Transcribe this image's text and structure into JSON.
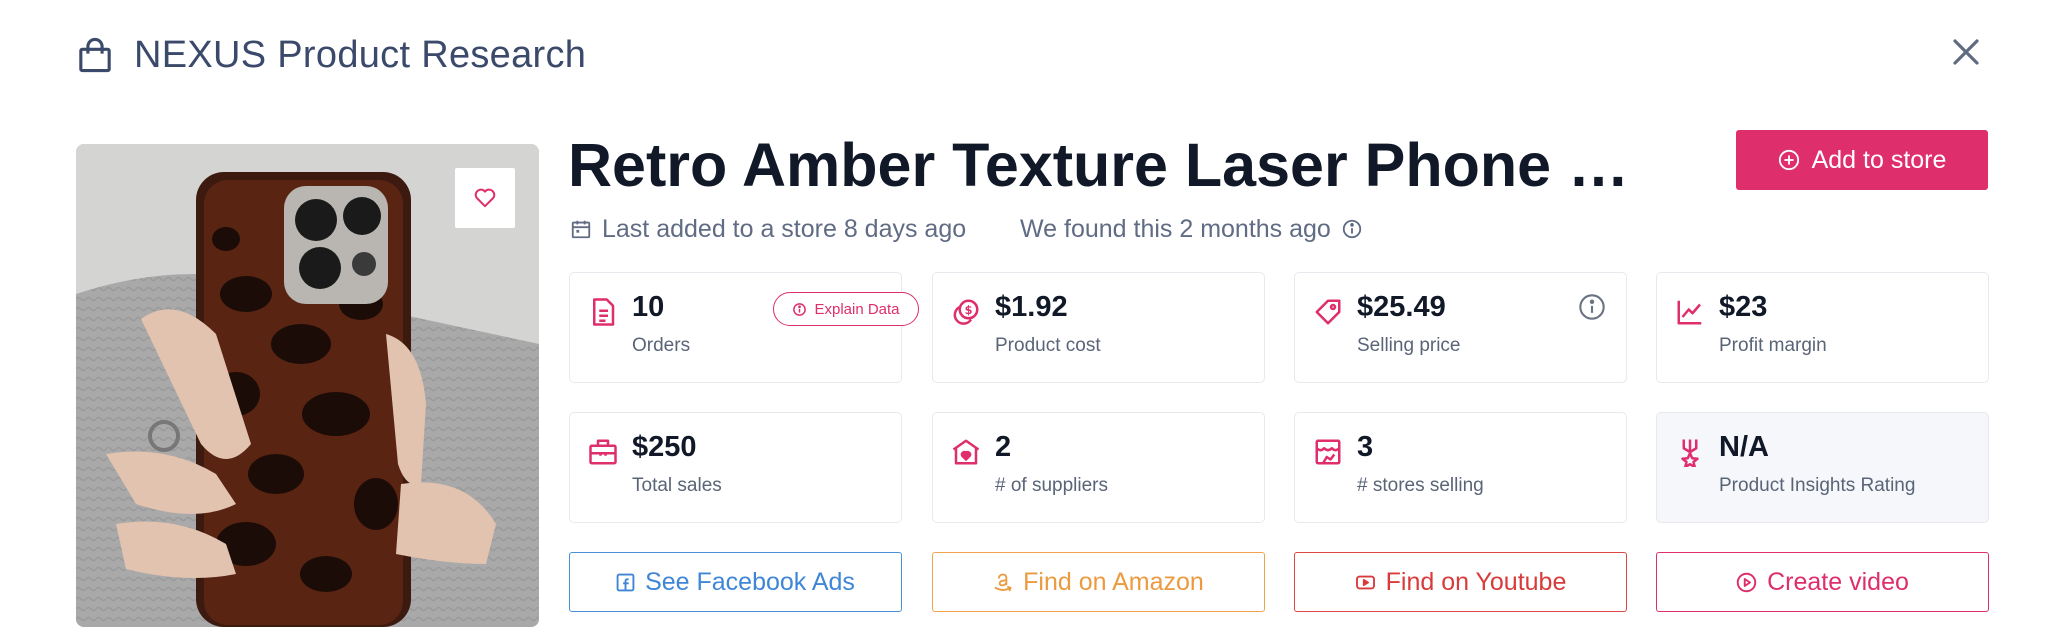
{
  "header": {
    "title": "NEXUS Product Research",
    "icon": "shopping-bag-icon"
  },
  "product": {
    "title": "Retro Amber Texture Laser Phone Case for iPhone",
    "last_added": "Last added to a store 8 days ago",
    "found": "We found this 2 months ago"
  },
  "add_button": {
    "label": "Add to store"
  },
  "explain_button": {
    "label": "Explain Data"
  },
  "stats": [
    {
      "value": "10",
      "label": "Orders",
      "icon": "document-icon"
    },
    {
      "value": "$1.92",
      "label": "Product cost",
      "icon": "coins-icon"
    },
    {
      "value": "$25.49",
      "label": "Selling price",
      "icon": "price-tag-icon"
    },
    {
      "value": "$23",
      "label": "Profit margin",
      "icon": "chart-line-icon"
    },
    {
      "value": "$250",
      "label": "Total sales",
      "icon": "briefcase-icon"
    },
    {
      "value": "2",
      "label": "# of suppliers",
      "icon": "warehouse-icon"
    },
    {
      "value": "3",
      "label": "# stores selling",
      "icon": "storefront-icon"
    },
    {
      "value": "N/A",
      "label": "Product Insights Rating",
      "icon": "award-icon"
    }
  ],
  "actions": {
    "facebook": "See Facebook Ads",
    "amazon": "Find on Amazon",
    "youtube": "Find on Youtube",
    "video": "Create video"
  },
  "colors": {
    "accent": "#df2e6c",
    "facebook": "#3f86d6",
    "amazon": "#eb9a3f",
    "youtube": "#d93b3b",
    "heading": "#3b4a6b"
  }
}
